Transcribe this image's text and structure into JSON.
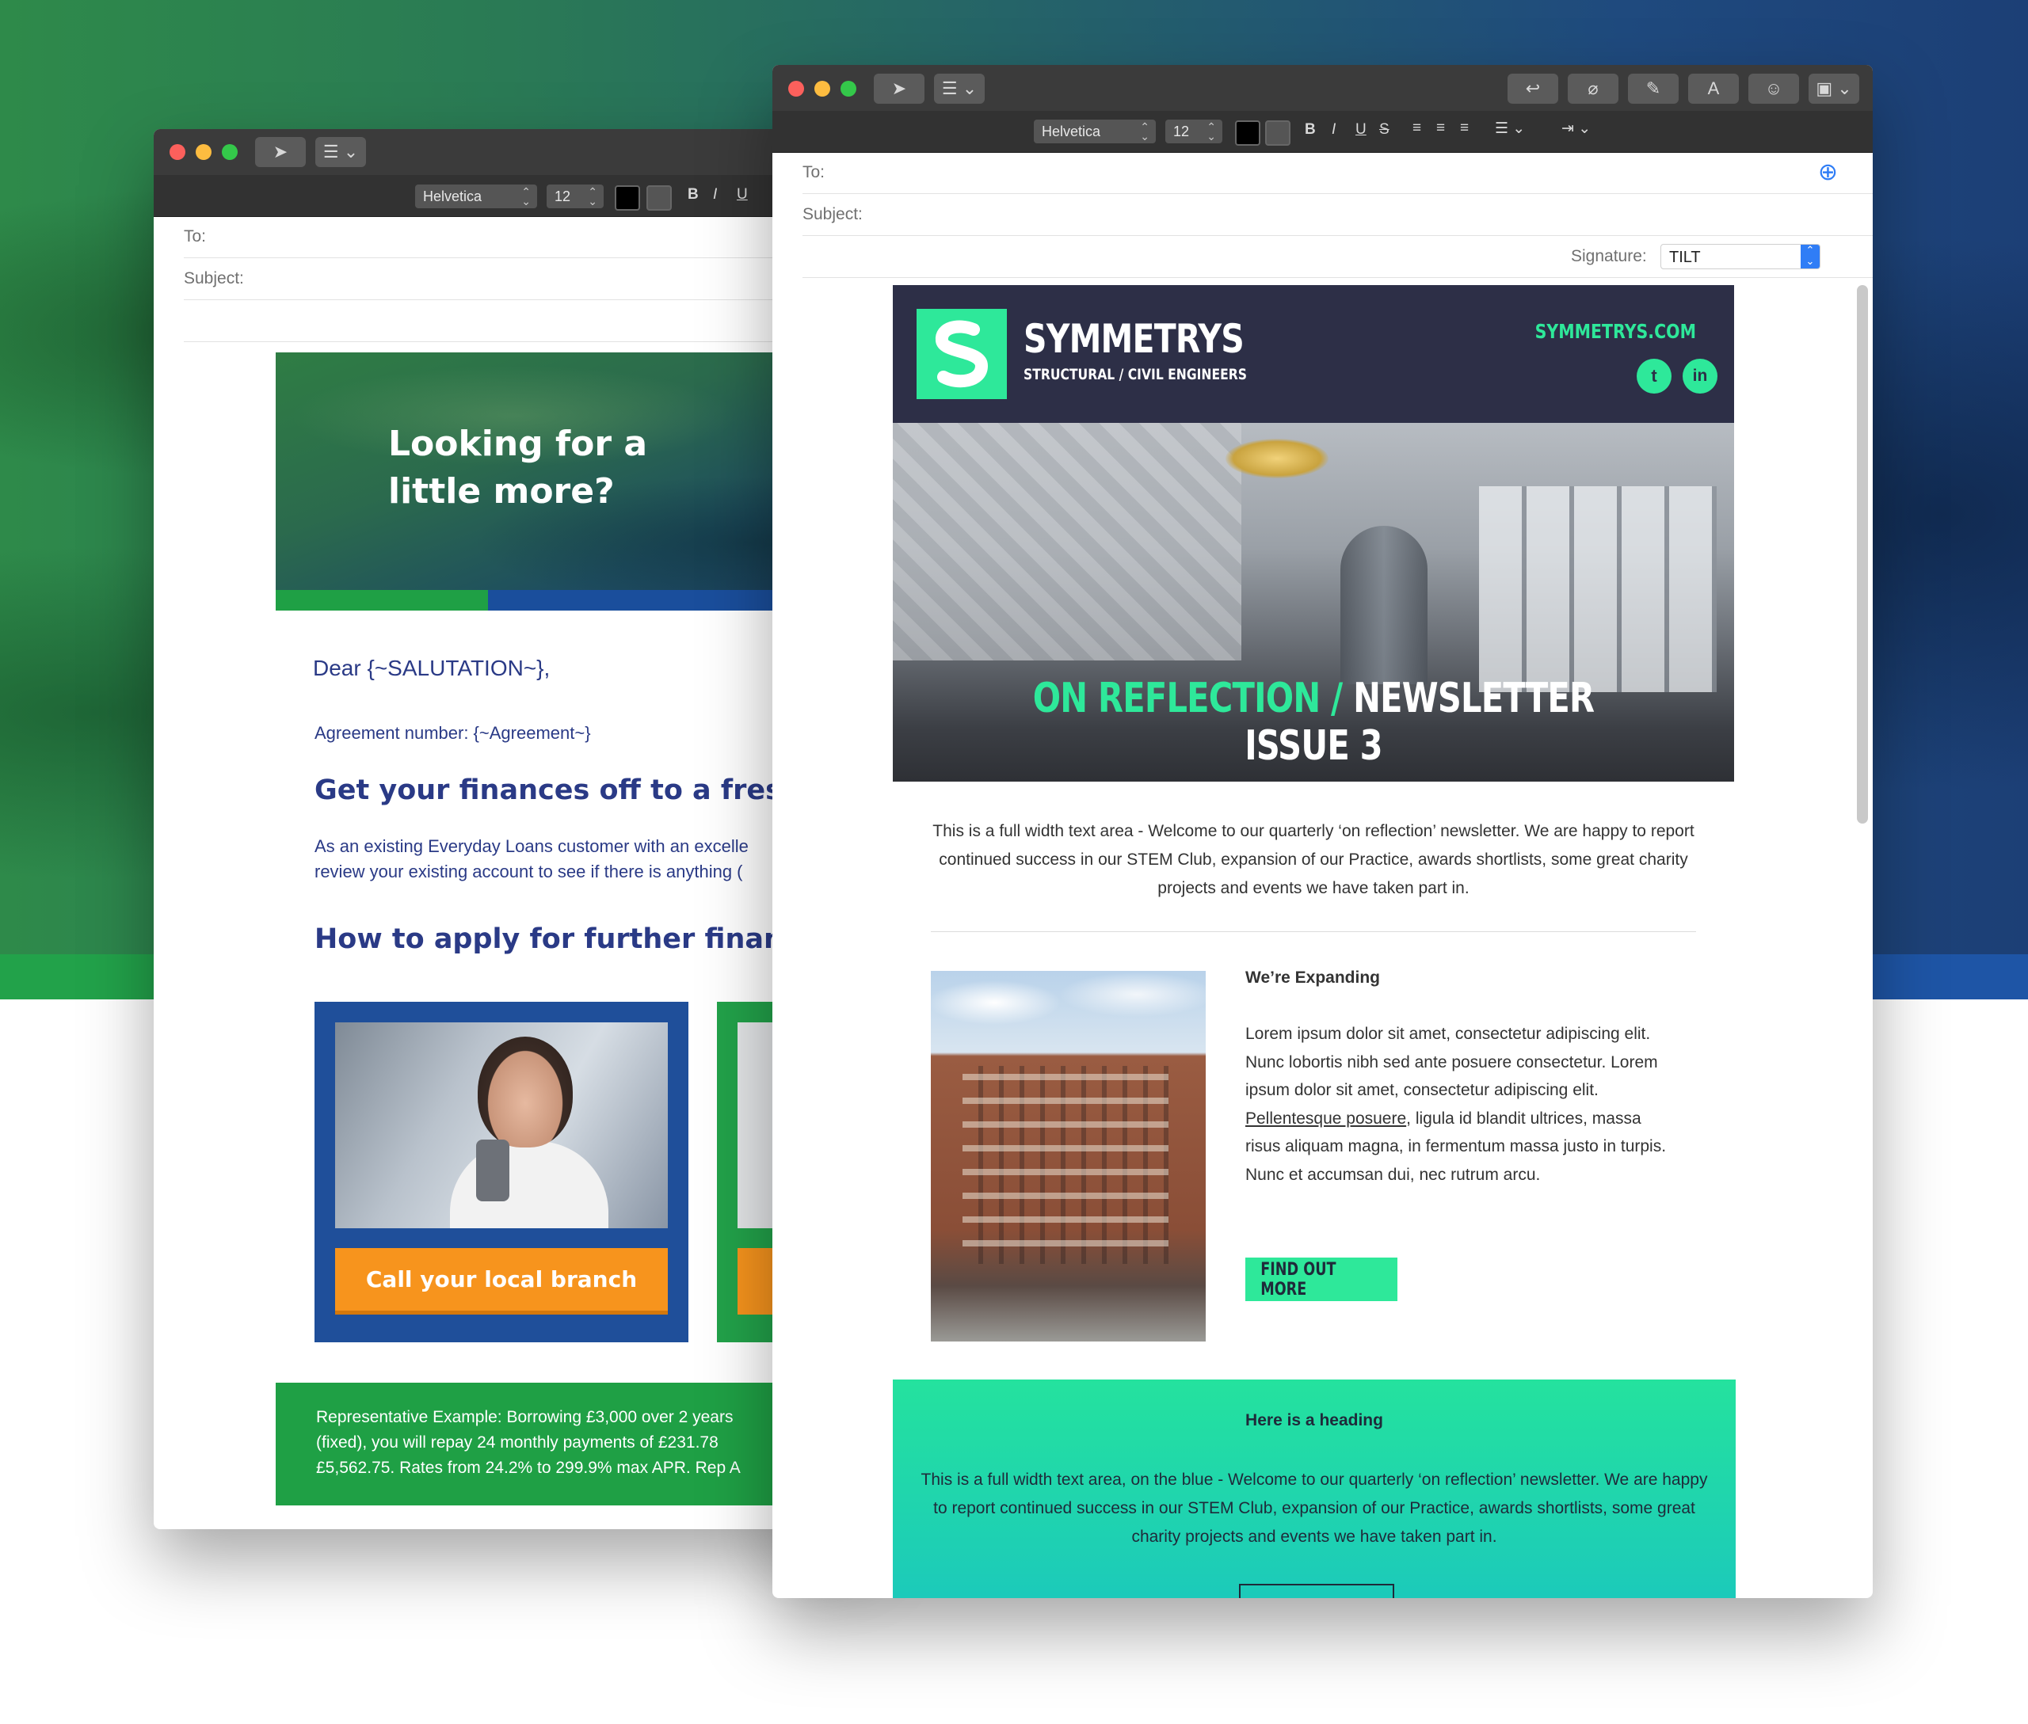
{
  "back_window": {
    "font": "Helvetica",
    "size": "12",
    "to_label": "To:",
    "subject_label": "Subject:",
    "hero_title": "Looking for a little more?",
    "salutation": "Dear {~SALUTATION~},",
    "agreement": "Agreement number: {~Agreement~}",
    "heading1": "Get your finances off to a fresh star",
    "para_line1": "As an existing Everyday Loans customer with an excelle",
    "para_line2": "review your existing account to see if there is anything (",
    "heading2": "How to apply for further finance:",
    "cta_label": "Call your local branch",
    "rep_line1": "Representative Example: Borrowing £3,000 over 2 years",
    "rep_line2": "(fixed), you will repay 24 monthly payments of £231.78",
    "rep_line3": "£5,562.75. Rates from 24.2% to 299.9% max APR. Rep A"
  },
  "front_window": {
    "font": "Helvetica",
    "size": "12",
    "to_label": "To:",
    "subject_label": "Subject:",
    "signature_label": "Signature:",
    "signature_value": "TILT",
    "brand": "SYMMETRYS",
    "tagline": "STRUCTURAL / CIVIL ENGINEERS",
    "website": "SYMMETRYS.COM",
    "hero_title_green": "ON REFLECTION /",
    "hero_title_white": "NEWSLETTER ISSUE 3",
    "intro": "This is a full width text area - Welcome to our quarterly ‘on reflection’ newsletter.  We are happy to report continued success in our STEM Club, expansion of our Practice, awards shortlists, some great charity projects and events we have taken part in.",
    "article_heading": "We’re Expanding",
    "article_body_1": "Lorem ipsum dolor sit amet, consectetur adipiscing elit. Nunc lobortis nibh sed ante posuere consectetur. Lorem ipsum dolor sit amet, consectetur adipiscing elit. ",
    "article_link": "Pellentesque posuere",
    "article_body_2": ", ligula id blandit ultrices, massa risus aliquam magna, in fermentum massa justo in turpis. Nunc et accumsan dui, nec rutrum arcu.",
    "button_label": "FIND OUT MORE",
    "blue_heading": "Here is a heading",
    "blue_text": "This is a full width text area, on the blue - Welcome to our quarterly ‘on reflection’ newsletter. We are happy to report continued success in our STEM Club, expansion of our Practice, awards shortlists, some great charity projects and events we have taken part in."
  },
  "icons": {
    "send": "paper-plane-icon",
    "header_menu": "list-icon",
    "reply": "reply-icon",
    "attach": "paperclip-icon",
    "markup": "markup-icon",
    "format": "font-icon",
    "emoji": "emoji-icon",
    "photo": "photo-browser-icon",
    "add_contact": "plus-circle-icon"
  },
  "colors": {
    "accent_green": "#2ee89a",
    "navy": "#2d2f47",
    "loan_blue": "#1f4f9a",
    "loan_green": "#1fa045",
    "loan_orange": "#f7941d"
  }
}
